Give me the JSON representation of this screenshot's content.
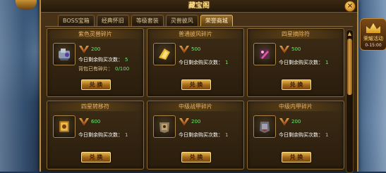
{
  "window": {
    "title": "藏宝阁",
    "close_label": "×"
  },
  "tabs": [
    {
      "label": "BOSS宝箱",
      "active": false
    },
    {
      "label": "经典怀旧",
      "active": false
    },
    {
      "label": "等级套装",
      "active": false
    },
    {
      "label": "灵兽披风",
      "active": false
    },
    {
      "label": "荣誉商城",
      "active": true
    }
  ],
  "event_badge": {
    "label": "荣耀活动",
    "sub": "0-15:00"
  },
  "cards": [
    {
      "title": "紫色灵兽碎片",
      "icon": "beast-shard-icon",
      "price": "200",
      "remaining_label": "今日剩余购买次数：",
      "remaining_value": "5",
      "owned_label": "背包已有碎片：",
      "owned_value": "0/100",
      "button": "兑 换"
    },
    {
      "title": "普通披风碎片",
      "icon": "cloak-shard-icon",
      "price": "500",
      "remaining_label": "今日剩余购买次数：",
      "remaining_value": "1",
      "button": "兑 换"
    },
    {
      "title": "四星摘除符",
      "icon": "star-removal-icon",
      "price": "500",
      "remaining_label": "今日剩余购买次数：",
      "remaining_value": "1",
      "button": "兑 换"
    },
    {
      "title": "四星转移符",
      "icon": "star-transfer-icon",
      "price": "600",
      "remaining_label": "今日剩余购买次数：",
      "remaining_value": "1",
      "button": "兑 换"
    },
    {
      "title": "中级战甲碎片",
      "icon": "battle-armor-icon",
      "price": "200",
      "remaining_label": "今日剩余购买次数：",
      "remaining_value": "1",
      "button": "兑 换"
    },
    {
      "title": "中级内甲碎片",
      "icon": "inner-armor-icon",
      "price": "200",
      "remaining_label": "今日剩余购买次数：",
      "remaining_value": "1",
      "button": "兑 换"
    }
  ],
  "colors": {
    "accent": "#e0b258",
    "price_green": "#6ee86e",
    "title_gold": "#ffe08a"
  }
}
